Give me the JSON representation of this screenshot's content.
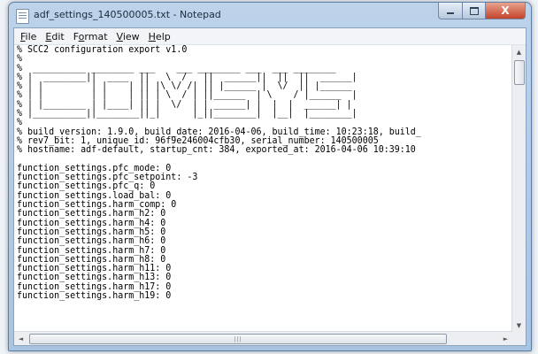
{
  "window": {
    "title": "adf_settings_140500005.txt - Notepad"
  },
  "caption_buttons": {
    "close_glyph": "X"
  },
  "menu": {
    "items": [
      {
        "accel": "F",
        "rest": "ile"
      },
      {
        "accel": "E",
        "rest": "dit"
      },
      {
        "pre": "F",
        "accel": "o",
        "rest": "rmat"
      },
      {
        "accel": "V",
        "rest": "iew"
      },
      {
        "accel": "H",
        "rest": "elp"
      }
    ]
  },
  "document": {
    "lines": [
      "% SCC2 configuration export v1.0",
      "%",
      "%  __________ ________ ___    ___ ________ ___  ___ ________",
      "% |  ________||  ____  ||   \\  /   ||  ______||  ||  ||  ______|",
      "% | |         | |    | || |\\ \\/ /| || |______ |  \\/  || |______",
      "% | |         | |    | || | \\  / | ||______  | \\    / |______  |",
      "% | |________ | |____| || |  \\/  | | ______| |  |  |  ______| |",
      "% |__________||________||_|      |_||________|  |__|  |________|",
      "%",
      "% build_version: 1.9.0, build_date: 2016-04-06, build_time: 10:23:18, build_",
      "% rev7_bit: 1, unique_id: 96f9e246004cfb30, serial_number: 140500005",
      "% hostname: adf-default, startup_cnt: 384, exported_at: 2016-04-06 10:39:10",
      "",
      "function_settings.pfc_mode: 0",
      "function_settings.pfc_setpoint: -3",
      "function_settings.pfc_q: 0",
      "function_settings.load_bal: 0",
      "function_settings.harm_comp: 0",
      "function_settings.harm_h2: 0",
      "function_settings.harm_h4: 0",
      "function_settings.harm_h5: 0",
      "function_settings.harm_h6: 0",
      "function_settings.harm_h7: 0",
      "function_settings.harm_h8: 0",
      "function_settings.harm_h11: 0",
      "function_settings.harm_h13: 0",
      "function_settings.harm_h17: 0",
      "function_settings.harm_h19: 0"
    ]
  },
  "scrollbars": {
    "up": "▲",
    "down": "▼",
    "left": "◄",
    "right": "►",
    "grip": "|||"
  },
  "colors": {
    "close_button": "#c4432b",
    "titlebar": "#bcd3ea"
  }
}
